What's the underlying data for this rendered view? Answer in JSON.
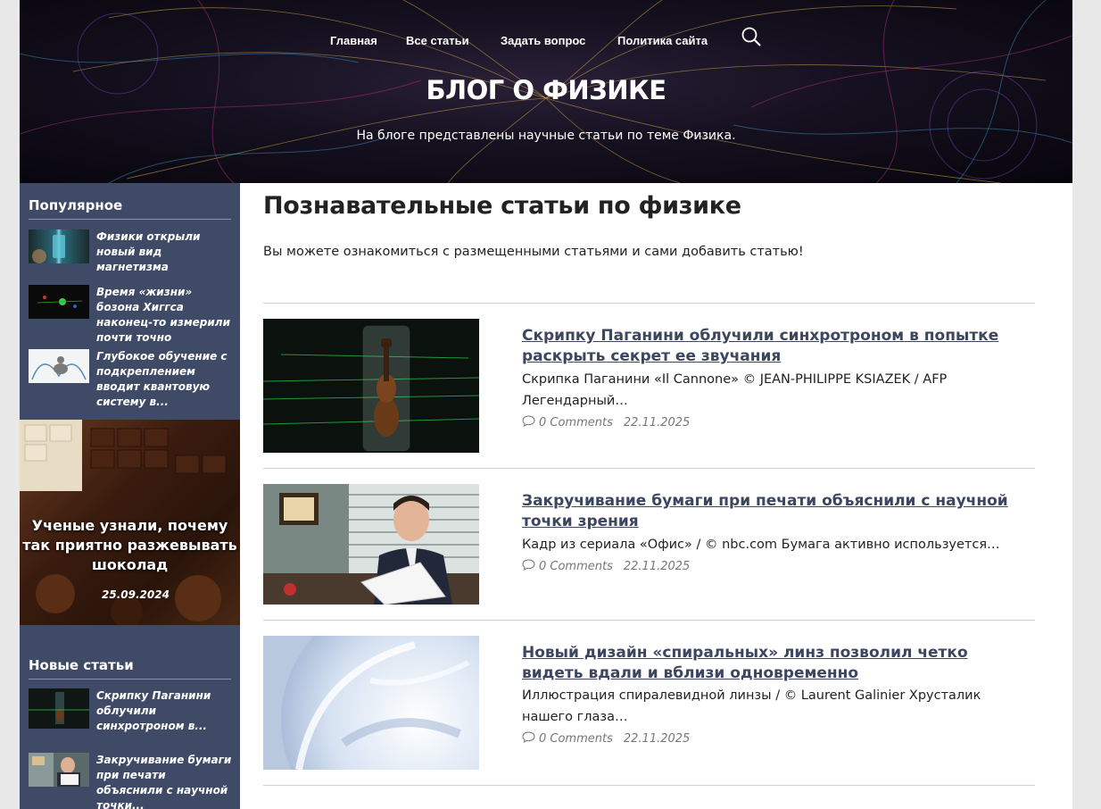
{
  "header": {
    "nav": [
      "Главная",
      "Все статьи",
      "Задать вопрос",
      "Политика сайта"
    ],
    "title": "БЛОГ О ФИЗИКЕ",
    "description": "На блоге представлены научные статьи по теме Физика."
  },
  "sidebar": {
    "popular_title": "Популярное",
    "popular": [
      {
        "text": "Физики открыли новый вид магнетизма"
      },
      {
        "text": "Время «жизни» бозона Хиггса наконец-то измерили почти точно"
      },
      {
        "text": "Глубокое обучение с подкреплением вводит квантовую систему в..."
      }
    ],
    "feature": {
      "title": "Ученые узнали, почему так приятно разжевывать шоколад",
      "date": "25.09.2024"
    },
    "new_title": "Новые статьи",
    "new": [
      {
        "text": "Скрипку Паганини облучили синхротроном в..."
      },
      {
        "text": "Закручивание бумаги при печати объяснили с научной точки..."
      }
    ]
  },
  "main": {
    "title": "Познавательные статьи по физике",
    "intro": "Вы можете ознакомиться с размещенными статьями и сами добавить статью!",
    "posts": [
      {
        "title": "Скрипку Паганини облучили синхротроном в попытке раскрыть секрет ее звучания",
        "excerpt": "Скрипка Паганини «Il Cannone» © JEAN-PHILIPPE KSIAZEK / AFP Легендарный…",
        "comments": "0 Comments",
        "date": "22.11.2025"
      },
      {
        "title": "Закручивание бумаги при печати объяснили с научной точки зрения",
        "excerpt": "Кадр из сериала «Офис» / © nbc.com Бумага активно используется…",
        "comments": "0 Comments",
        "date": "22.11.2025"
      },
      {
        "title": "Новый дизайн «спиральных» линз позволил четко видеть вдали и вблизи одновременно",
        "excerpt": "Иллюстрация спиралевидной линзы / © Laurent Galinier Хрусталик нашего глаза…",
        "comments": "0 Comments",
        "date": "22.11.2025"
      }
    ]
  }
}
